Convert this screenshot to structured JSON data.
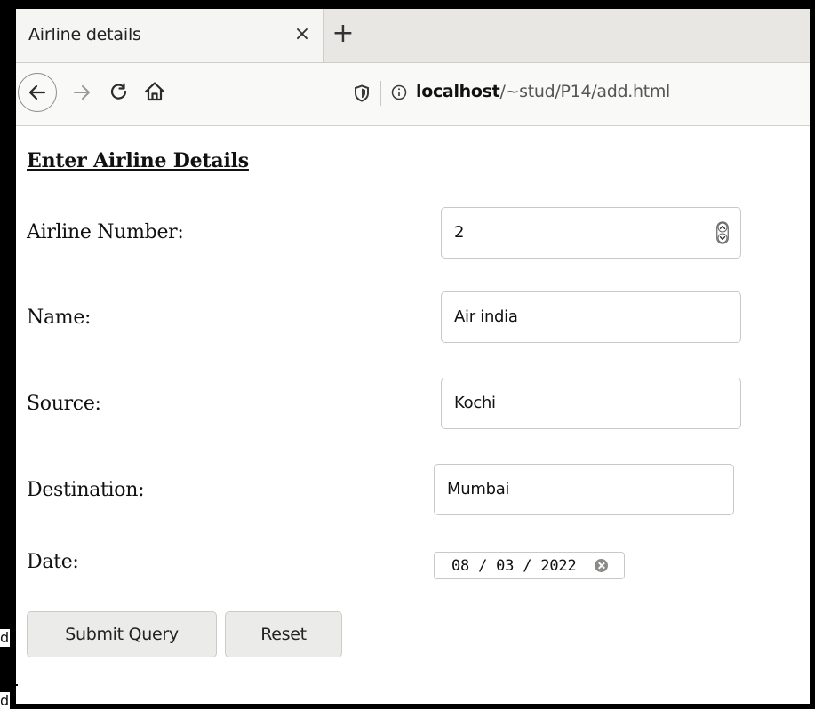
{
  "browser": {
    "tab": {
      "title": "Airline details",
      "close_glyph": "×"
    },
    "new_tab_glyph": "+",
    "address": {
      "host": "localhost",
      "path": "/~stud/P14/add.html"
    },
    "icons": {
      "back": "back-arrow-icon",
      "forward": "forward-arrow-icon",
      "reload": "reload-icon",
      "home": "home-icon",
      "tracking": "shield-icon",
      "site_info": "info-icon"
    }
  },
  "form": {
    "heading": "Enter Airline Details",
    "fields": {
      "airline_number": {
        "label": "Airline Number:",
        "value": "2"
      },
      "name": {
        "label": "Name:",
        "value": "Air india"
      },
      "source": {
        "label": "Source:",
        "value": "Kochi"
      },
      "destination": {
        "label": "Destination:",
        "value": "Mumbai"
      },
      "date": {
        "label": "Date:",
        "value": "08 / 03 / 2022"
      }
    },
    "buttons": {
      "submit": "Submit Query",
      "reset": "Reset"
    }
  },
  "edge_text": {
    "first": "d",
    "second": "d"
  }
}
